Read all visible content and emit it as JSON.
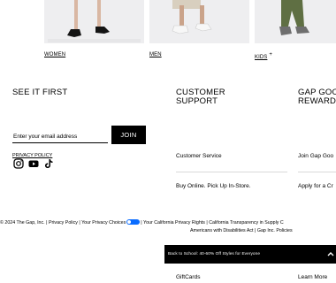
{
  "categories": [
    {
      "label": "WOMEN"
    },
    {
      "label": "MEN"
    },
    {
      "label": "KIDS",
      "marker": "+"
    }
  ],
  "sections": {
    "see_it_first": "SEE IT FIRST",
    "customer_support_line1": "CUSTOMER",
    "customer_support_line2": "SUPPORT",
    "rewards_line1": "GAP GOO",
    "rewards_line2": "REWARDS"
  },
  "signup": {
    "email_placeholder": "Enter your email address",
    "join_label": "JOIN",
    "privacy_label": "PRIVACY POLICY"
  },
  "social_icons": [
    "instagram-icon",
    "youtube-icon",
    "tiktok-icon"
  ],
  "support_links": [
    "Customer Service",
    "Buy Online. Pick Up In-Store."
  ],
  "rewards_links": [
    "Join Gap Goo",
    "Apply for a Cr"
  ],
  "legal": {
    "row1": "© 2024 The Gap, Inc. | Privacy Policy | Your Privacy Choices",
    "row1_tail": "| Your California Privacy Rights | California Transparency in Supply C",
    "row2": "Americans with Disabilities Act | Gap Inc. Policies"
  },
  "promo": {
    "text": "Back to School: 40-60% Off Styles for Everyone"
  },
  "bottom_links": [
    "GiftCards",
    "Learn More"
  ],
  "colors": {
    "background": "#ffffff",
    "text": "#000000",
    "tile_bg": "#efeff0",
    "promo_bg": "#000000",
    "privacy_toggle": "#0a6cff"
  }
}
